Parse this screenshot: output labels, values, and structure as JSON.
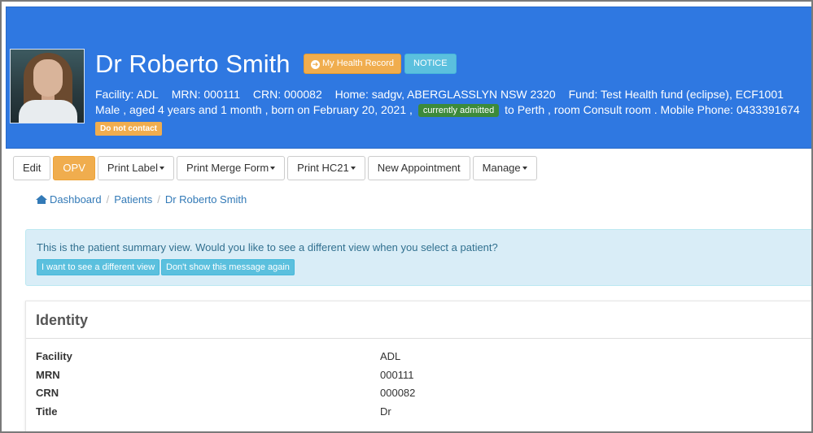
{
  "patient": {
    "name": "Dr Roberto Smith",
    "my_health_record_label": "My Health Record",
    "notice_label": "NOTICE",
    "facility": "Facility: ADL",
    "mrn": "MRN: 000111",
    "crn": "CRN: 000082",
    "home": "Home: sadgv, ABERGLASSLYN NSW 2320",
    "fund": "Fund: Test Health fund (eclipse), ECF1001",
    "summary_pre": "Male , aged 4 years and 1 month , born on February 20, 2021 ,",
    "admitted_badge": "currently admitted",
    "summary_post": "to Perth , room Consult room . Mobile Phone: 0433391674",
    "do_not_contact": "Do not contact"
  },
  "toolbar": {
    "edit": "Edit",
    "opv": "OPV",
    "print_label": "Print Label",
    "print_merge_form": "Print Merge Form",
    "print_hc21": "Print HC21",
    "new_appointment": "New Appointment",
    "manage": "Manage"
  },
  "breadcrumb": {
    "dashboard": "Dashboard",
    "patients": "Patients",
    "current": "Dr Roberto Smith"
  },
  "alert": {
    "message": "This is the patient summary view. Would you like to see a different view when you select a patient?",
    "different_view_button": "I want to see a different view",
    "dont_show_button": "Don't show this message again"
  },
  "identity": {
    "title": "Identity",
    "rows": [
      {
        "label": "Facility",
        "value": "ADL"
      },
      {
        "label": "MRN",
        "value": "000111"
      },
      {
        "label": "CRN",
        "value": "000082"
      },
      {
        "label": "Title",
        "value": "Dr"
      }
    ]
  },
  "colors": {
    "header_blue": "#2f78e1",
    "warning_orange": "#f0ad4e",
    "info_cyan": "#5bc0de",
    "success_green": "#3c8a3a",
    "link_blue": "#337ab7"
  }
}
